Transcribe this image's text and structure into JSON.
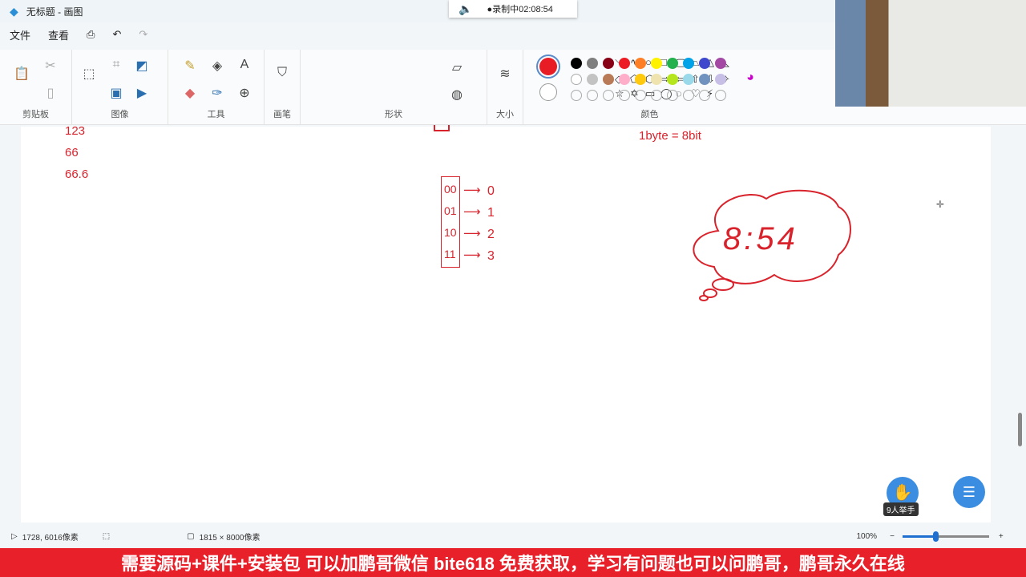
{
  "window": {
    "title": "无标题 - 画图"
  },
  "recording": {
    "label": "●录制中02:08:54"
  },
  "menu": {
    "file": "文件",
    "view": "查看"
  },
  "ribbon": {
    "groups": {
      "clipboard": "剪贴板",
      "image": "图像",
      "tools": "工具",
      "brush": "画笔",
      "shapes": "形状",
      "size": "大小",
      "colors": "颜色"
    }
  },
  "shapes": [
    "＼",
    "∿",
    "○",
    "□",
    "▢",
    "⏢",
    "△",
    "◺",
    "◇",
    "⬠",
    "⬡",
    "⇨",
    "⇦",
    "⇧",
    "⇩",
    "✧",
    "☆",
    "✡",
    "▭",
    "◯",
    "◌",
    "♡",
    "⚡",
    ""
  ],
  "palette": {
    "primary": "#e81c24",
    "secondary": "#ffffff",
    "row1": [
      "#000000",
      "#7f7f7f",
      "#880015",
      "#ed1c24",
      "#ff7f27",
      "#fff200",
      "#22b14c",
      "#00a2e8",
      "#3f48cc",
      "#a349a4"
    ],
    "row2": [
      "#ffffff",
      "#c3c3c3",
      "#b97a57",
      "#ffaec9",
      "#ffc90e",
      "#efe4b0",
      "#b5e61d",
      "#99d9ea",
      "#7092be",
      "#c8bfe7"
    ]
  },
  "canvas": {
    "left_numbers": [
      "123",
      "66",
      "66.6"
    ],
    "byte_note": "1byte = 8bit",
    "mapping": [
      {
        "bin": "00",
        "dec": "0"
      },
      {
        "bin": "01",
        "dec": "1"
      },
      {
        "bin": "10",
        "dec": "2"
      },
      {
        "bin": "11",
        "dec": "3"
      }
    ],
    "cloud_text": "8:54"
  },
  "status": {
    "cursor": "1728, 6016像素",
    "canvas_size": "1815 × 8000像素",
    "zoom": "100%"
  },
  "float": {
    "raise_hand": "9人举手"
  },
  "banner": "需要源码+课件+安装包 可以加鹏哥微信 bite618 免费获取，学习有问题也可以问鹏哥，鹏哥永久在线"
}
